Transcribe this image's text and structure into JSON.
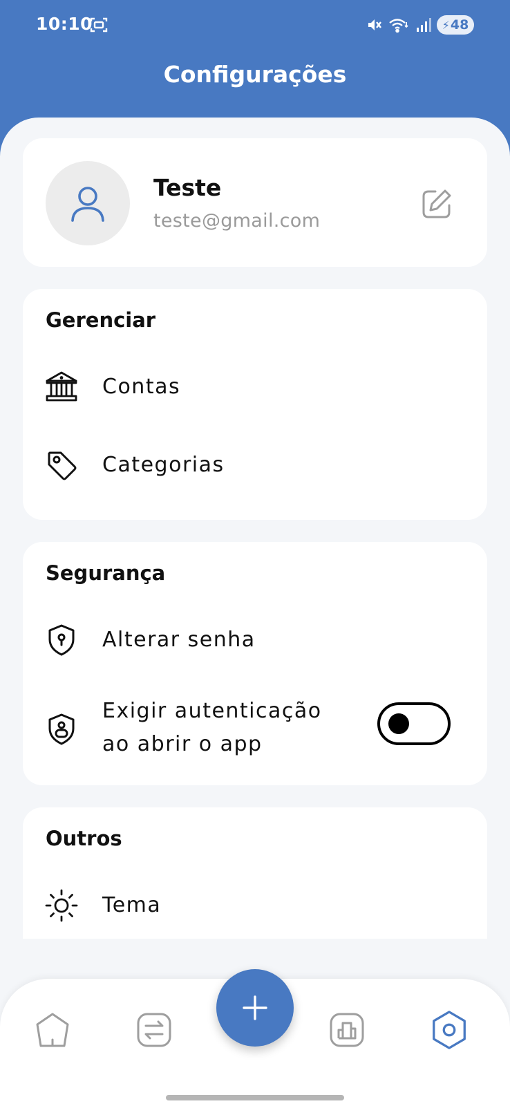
{
  "status_bar": {
    "time": "10:10",
    "battery": "48",
    "icons": [
      "screenshot-icon",
      "mute-icon",
      "wifi-icon",
      "signal-icon",
      "battery-charging-icon"
    ]
  },
  "header": {
    "title": "Configurações"
  },
  "profile": {
    "name": "Teste",
    "email": "teste@gmail.com",
    "avatar_icon": "user-icon",
    "edit_icon": "edit-icon"
  },
  "manage": {
    "title": "Gerenciar",
    "items": [
      {
        "label": "Contas",
        "icon": "bank-icon"
      },
      {
        "label": "Categorias",
        "icon": "tag-icon"
      }
    ]
  },
  "security": {
    "title": "Segurança",
    "items": [
      {
        "label": "Alterar senha",
        "icon": "shield-key-icon"
      },
      {
        "label_line1": "Exigir autenticação",
        "label_line2": "ao abrir o app",
        "icon": "shield-lock-icon",
        "toggle_on": false
      }
    ]
  },
  "others": {
    "title": "Outros",
    "items": [
      {
        "label": "Tema",
        "icon": "sun-icon"
      }
    ]
  },
  "bottom_nav": {
    "items": [
      "home-icon",
      "transactions-icon",
      "add-icon",
      "reports-icon",
      "settings-icon"
    ],
    "active": "settings-icon"
  },
  "colors": {
    "primary": "#4879c2",
    "background": "#f4f6f9",
    "card": "#ffffff",
    "muted_text": "#9a9a9a",
    "inactive_icon": "#9e9e9e"
  }
}
